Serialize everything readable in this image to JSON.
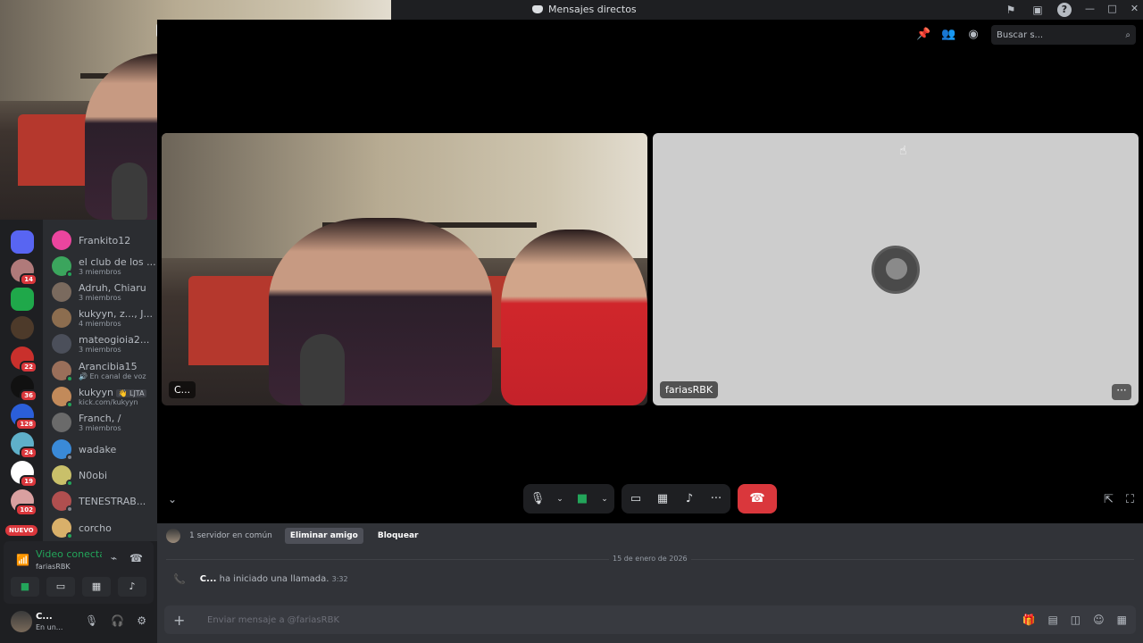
{
  "window": {
    "title": "Mensajes directos",
    "controls": [
      "—",
      "□",
      "✕"
    ]
  },
  "toolbar": {
    "search_placeholder": "Buscar s..."
  },
  "call": {
    "tiles": [
      {
        "name": "C..."
      },
      {
        "name": "fariasRBK"
      }
    ]
  },
  "dms": [
    {
      "name": "Frankito12",
      "sub": "",
      "color": "#eb459e"
    },
    {
      "name": "el club de los ...",
      "sub": "3 miembros",
      "color": "#3ba55d"
    },
    {
      "name": "Adruh, Chiaru",
      "sub": "3 miembros",
      "color": "#7a6a5e"
    },
    {
      "name": "kukyyn, z..., J...",
      "sub": "4 miembros",
      "color": "#8c6d4f"
    },
    {
      "name": "mateogioia2...",
      "sub": "3 miembros",
      "color": "#4b4f5a"
    },
    {
      "name": "Arancibia15",
      "sub": "🔊 En canal de voz",
      "color": "#9a6f5a"
    },
    {
      "name": "kukyyn",
      "tag": "👋 LJTA",
      "sub": "kick.com/kukyyn",
      "color": "#c28a5a"
    },
    {
      "name": "Franch, /",
      "sub": "3 miembros",
      "color": "#6a6a6a"
    },
    {
      "name": "wadake",
      "sub": "",
      "color": "#3a8ad8"
    },
    {
      "name": "N0obi",
      "sub": "",
      "color": "#c9c06a"
    },
    {
      "name": "TENESTRAB...",
      "sub": "",
      "color": "#b04f4f"
    },
    {
      "name": "corcho",
      "sub": "",
      "color": "#d9b06a"
    }
  ],
  "servers": [
    {
      "badge": "",
      "color": "#5865f2"
    },
    {
      "badge": "14",
      "color": "#b07a7a"
    },
    {
      "badge": "",
      "color": "#1fa84a"
    },
    {
      "badge": "",
      "color": "#4d3a2a"
    },
    {
      "badge": "22",
      "color": "#c9302c"
    },
    {
      "badge": "36",
      "color": "#111111"
    },
    {
      "badge": "128",
      "color": "#2b5fd9"
    },
    {
      "badge": "24",
      "color": "#5fb0c9"
    },
    {
      "badge": "19",
      "color": "#ffffff"
    },
    {
      "badge": "102",
      "color": "#d9a0a0"
    }
  ],
  "new_pill": "NUEVO",
  "voice": {
    "status": "Video conectado",
    "channel": "fariasRBK"
  },
  "user": {
    "name": "C...",
    "status": "En un..."
  },
  "profile_bar": {
    "mutual": "1 servidor en común",
    "remove": "Eliminar amigo",
    "block": "Bloquear"
  },
  "chat": {
    "date": "15 de enero de 2026",
    "call_user": "C...",
    "call_text": "ha iniciado una llamada.",
    "call_time": "3:32",
    "input_placeholder": "Enviar mensaje a @fariasRBK"
  }
}
